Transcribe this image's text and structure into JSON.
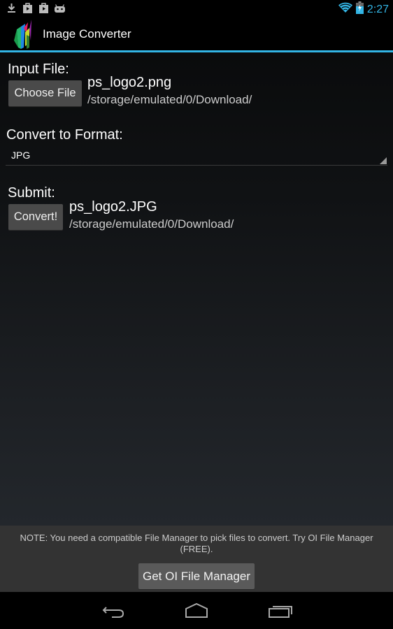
{
  "status_bar": {
    "notification_icons": [
      "download-icon",
      "play-store-icon",
      "play-store-icon",
      "android-icon"
    ],
    "wifi_icon": "wifi-icon",
    "battery_icon": "battery-charging-icon",
    "time": "2:27",
    "accent_color": "#33b5e5"
  },
  "action_bar": {
    "app_icon": "image-converter-logo",
    "title": "Image Converter"
  },
  "input_file": {
    "label": "Input File:",
    "button_label": "Choose File",
    "file_name": "ps_logo2.png",
    "file_path": "/storage/emulated/0/Download/"
  },
  "format": {
    "label": "Convert to Format:",
    "selected": "JPG"
  },
  "submit": {
    "label": "Submit:",
    "button_label": "Convert!",
    "output_name": "ps_logo2.JPG",
    "output_path": "/storage/emulated/0/Download/"
  },
  "note": {
    "text": "NOTE: You need a compatible File Manager to pick files to convert. Try OI File Manager (FREE).",
    "button_label": "Get OI File Manager"
  },
  "nav_bar": {
    "buttons": [
      "back-icon",
      "home-icon",
      "recent-apps-icon"
    ]
  }
}
